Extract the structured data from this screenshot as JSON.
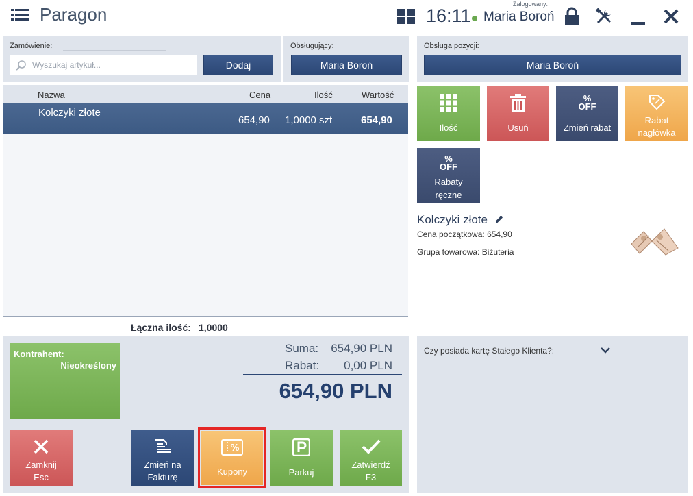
{
  "header": {
    "title": "Paragon",
    "clock": "16:11",
    "logged_label": "Zalogowany:",
    "user": "Maria Boroń"
  },
  "order": {
    "label": "Zamówienie:",
    "search_placeholder": "Wyszukaj artykuł...",
    "add_button": "Dodaj"
  },
  "served_by": {
    "label": "Obsługujący:",
    "value": "Maria Boroń"
  },
  "position_service": {
    "label": "Obsługa pozycji:",
    "value": "Maria Boroń"
  },
  "table": {
    "columns": [
      "Nazwa",
      "Cena",
      "Ilość",
      "Wartość"
    ],
    "rows": [
      {
        "name": "Kolczyki złote",
        "price": "654,90",
        "qty": "1,0000 szt",
        "value": "654,90"
      }
    ],
    "total_qty_label": "Łączna ilość:",
    "total_qty_value": "1,0000"
  },
  "actions": {
    "qty": "Ilość",
    "delete": "Usuń",
    "change_discount": "Zmień rabat",
    "header_discount_1": "Rabat",
    "header_discount_2": "nagłówka",
    "manual_discounts_1": "Rabaty",
    "manual_discounts_2": "ręczne",
    "off_pct": "%",
    "off_text": "OFF"
  },
  "product": {
    "name": "Kolczyki złote",
    "start_price_label": "Cena początkowa:",
    "start_price": "654,90",
    "group_label": "Grupa towarowa:",
    "group": "Biżuteria"
  },
  "customer": {
    "label": "Kontrahent:",
    "value": "Nieokreślony"
  },
  "summary": {
    "sum_label": "Suma:",
    "sum_value": "654,90 PLN",
    "discount_label": "Rabat:",
    "discount_value": "0,00 PLN",
    "total": "654,90 PLN"
  },
  "loyalty": {
    "question": "Czy posiada kartę Stałego Klienta?:"
  },
  "bottom": {
    "close_1": "Zamknij",
    "close_2": "Esc",
    "invoice_1": "Zmień na",
    "invoice_2": "Fakturę",
    "coupons": "Kupony",
    "park": "Parkuj",
    "confirm_1": "Zatwierdź",
    "confirm_2": "F3"
  },
  "colors": {
    "accent_blue": "#2c4775",
    "green": "#6ea94a",
    "red": "#cc5657",
    "navy": "#3a4a6d",
    "orange": "#efa64a",
    "highlight": "#e52626"
  }
}
